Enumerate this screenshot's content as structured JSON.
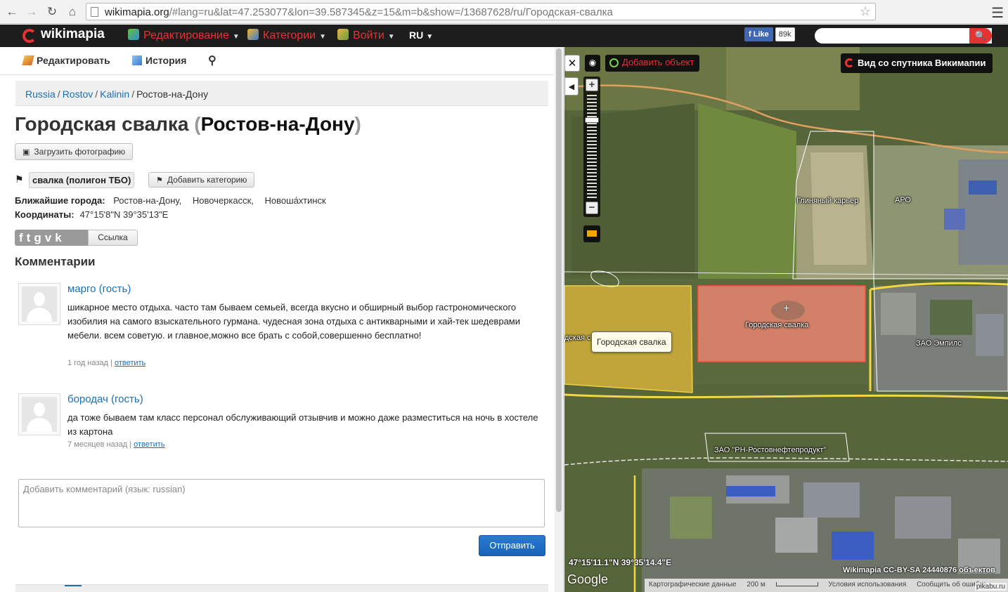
{
  "browser": {
    "url_host": "wikimapia.org",
    "url_rest": "/#lang=ru&lat=47.253077&lon=39.587345&z=15&m=b&show=/13687628/ru/Городская-свалка"
  },
  "topbar": {
    "logo": "wikimapia",
    "menu_edit": "Редактирование",
    "menu_categories": "Категории",
    "menu_login": "Войти",
    "lang": "RU",
    "fb_like": "Like",
    "fb_count": "89k",
    "search_placeholder": ""
  },
  "tabs": {
    "edit": "Редактировать",
    "history": "История"
  },
  "breadcrumb": [
    "Russia",
    "Rostov",
    "Kalinin",
    "Ростов-на-Дону"
  ],
  "place": {
    "name": "Городская свалка",
    "city": "Ростов-на-Дону",
    "upload_photo": "Загрузить фотографию",
    "category": "свалка (полигон ТБО)",
    "add_category": "Добавить категорию",
    "nearby_label": "Ближайшие города:",
    "nearby": [
      "Ростов-на-Дону,",
      "Новочеркасск,",
      "Новоша́хтинск"
    ],
    "coords_label": "Координаты:",
    "coords": "47°15'8\"N 39°35'13\"E",
    "share_link": "Ссылка"
  },
  "comments": {
    "heading": "Комментарии",
    "items": [
      {
        "author": "марго (гость)",
        "text": "шикарное место отдыха. часто там бываем семьей, всегда вкусно и обширный выбор гастрономического изобилия на самого взыскательного гурмана. чудесная зона отдыха с антикварными и хай-тек шедеврами мебели. всем советую. и главное,можно все брать с собой,совершенно бесплатно!",
        "time": "1 год назад",
        "reply": "ответить"
      },
      {
        "author": "бородач (гость)",
        "text": "да тоже бываем там класс персонал обслуживающий отзывчив и можно даже разместиться на ночь в хостеле из картона",
        "time": "7 месяцев назад",
        "reply": "ответить"
      }
    ],
    "input_placeholder": "Добавить комментарий (язык: russian)",
    "send": "Отправить"
  },
  "map": {
    "add_object": "Добавить объект",
    "satellite_view": "Вид со спутника Викимапии",
    "tooltip": "Городская свалка",
    "labels": {
      "landfill": "Городская свалка",
      "clay_pit": "Глиняный карьер",
      "aro": "АРО",
      "empils": "ЗАО Эмпилс",
      "rosneft": "ЗАО \"РН-Ростовнефтепродукт\"",
      "partial": "дская с"
    },
    "coords": "47°15'11.1\"N 39°35'14.4\"E",
    "attribution": "Wikimapia CC-BY-SA",
    "objects_count": "24440876 объектов",
    "google": "Google",
    "footer": {
      "map_data": "Картографические данные",
      "scale": "200 м",
      "terms": "Условия использования",
      "report": "Сообщить об ошибке"
    },
    "watermark": "pikabu.ru"
  },
  "colors": {
    "brand_red": "#e53232",
    "link_blue": "#1b6fb5",
    "landfill_fill": "#e88470",
    "yellow_poly": "#e6c030"
  }
}
